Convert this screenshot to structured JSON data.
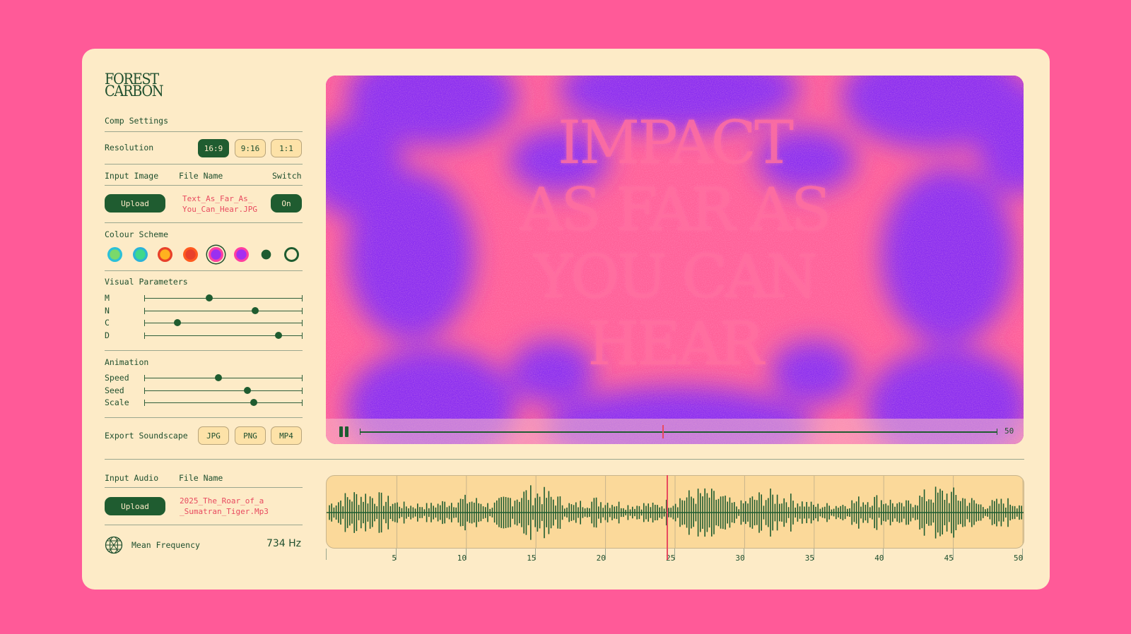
{
  "brand": {
    "logo_line1": "FOREST",
    "logo_line2": "CARBON"
  },
  "comp_settings": {
    "title": "Comp Settings",
    "resolution_label": "Resolution",
    "resolution_options": [
      "16:9",
      "9:16",
      "1:1"
    ],
    "resolution_selected": "16:9"
  },
  "input_image": {
    "col1": "Input Image",
    "col2": "File Name",
    "col3": "Switch",
    "upload_label": "Upload",
    "file_name_line1": "Text_As_Far_As_",
    "file_name_line2": "You_Can_Hear.JPG",
    "switch_value": "On"
  },
  "colour_scheme": {
    "title": "Colour Scheme",
    "swatches": [
      {
        "outer": "#2bc0d8",
        "inner": "#7ad96b"
      },
      {
        "outer": "#2bb3d8",
        "inner": "#3fd88c"
      },
      {
        "outer": "#e8402a",
        "inner": "#ffb21f"
      },
      {
        "outer": "#ff5a1f",
        "inner": "#e8402a"
      },
      {
        "outer": "#ff3fa0",
        "inner": "#9b2ff0"
      },
      {
        "outer": "#ff3fa0",
        "inner": "#a52ff0"
      },
      {
        "outer": "#1f5c30",
        "inner": "#1f5c30"
      },
      {
        "outer": "#1f5c30",
        "inner": "#fdebc7"
      }
    ],
    "selected_index": 4
  },
  "visual_parameters": {
    "title": "Visual Parameters",
    "sliders": [
      {
        "label": "M",
        "value": 0.41
      },
      {
        "label": "N",
        "value": 0.7
      },
      {
        "label": "C",
        "value": 0.21
      },
      {
        "label": "D",
        "value": 0.85
      }
    ]
  },
  "animation": {
    "title": "Animation",
    "sliders": [
      {
        "label": "Speed",
        "value": 0.47
      },
      {
        "label": "Seed",
        "value": 0.65
      },
      {
        "label": "Scale",
        "value": 0.69
      }
    ]
  },
  "export": {
    "label": "Export Soundscape",
    "options": [
      "JPG",
      "PNG",
      "MP4"
    ]
  },
  "input_audio": {
    "col1": "Input Audio",
    "col2": "File Name",
    "upload_label": "Upload",
    "file_name_line1": "2025_The_Roar_of_a",
    "file_name_line2": "_Sumatran_Tiger.Mp3"
  },
  "mean_frequency": {
    "label": "Mean Frequency",
    "value": "734 Hz"
  },
  "preview": {
    "lines": [
      "IMPACT",
      "AS FAR AS",
      "YOU CAN",
      "HEAR"
    ],
    "timeline_end_label": "50",
    "playhead_fraction": 0.475,
    "state": "playing"
  },
  "waveform": {
    "axis_ticks": [
      "5",
      "10",
      "15",
      "20",
      "25",
      "30",
      "35",
      "40",
      "45",
      "50"
    ],
    "axis_max": 50,
    "playhead_value": 24.5
  },
  "colors": {
    "background": "#ff5a98",
    "panel": "#fdebc7",
    "accent_green": "#1f5c30",
    "accent_red": "#e84a5f",
    "video_purple": "#8a2df0",
    "video_pink": "#ff6fa0",
    "wave_fill": "#fbd99a"
  }
}
